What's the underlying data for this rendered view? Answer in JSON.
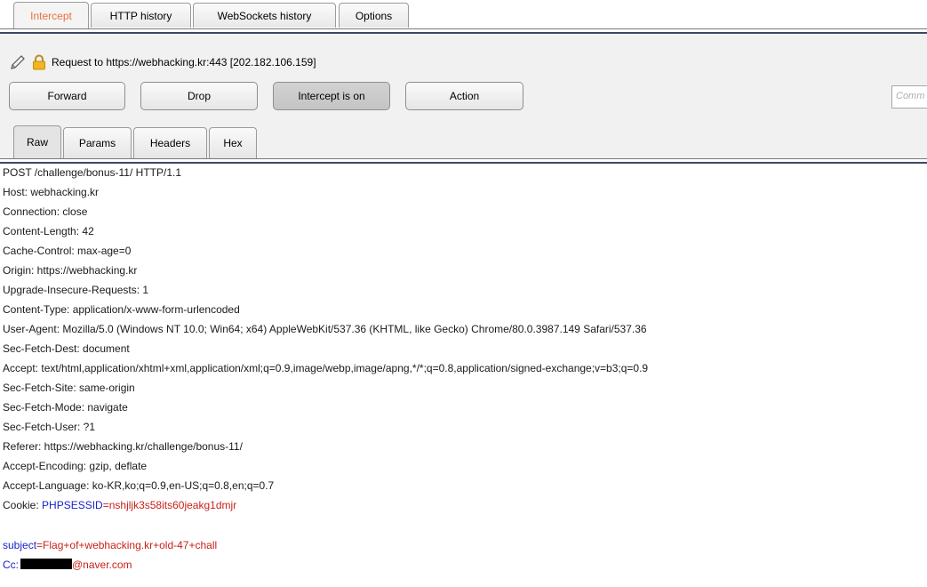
{
  "top_tabs": [
    {
      "label": "Intercept",
      "active": true
    },
    {
      "label": "HTTP history",
      "active": false
    },
    {
      "label": "WebSockets history",
      "active": false
    },
    {
      "label": "Options",
      "active": false
    }
  ],
  "request_line": "Request to https://webhacking.kr:443  [202.182.106.159]",
  "buttons": {
    "forward": "Forward",
    "drop": "Drop",
    "intercept": "Intercept is on",
    "action": "Action"
  },
  "comment_placeholder": "Comm",
  "sub_tabs": [
    {
      "label": "Raw",
      "active": true
    },
    {
      "label": "Params",
      "active": false
    },
    {
      "label": "Headers",
      "active": false
    },
    {
      "label": "Hex",
      "active": false
    }
  ],
  "headers": [
    "POST /challenge/bonus-11/ HTTP/1.1",
    "Host: webhacking.kr",
    "Connection: close",
    "Content-Length: 42",
    "Cache-Control: max-age=0",
    "Origin: https://webhacking.kr",
    "Upgrade-Insecure-Requests: 1",
    "Content-Type: application/x-www-form-urlencoded",
    "User-Agent: Mozilla/5.0 (Windows NT 10.0; Win64; x64) AppleWebKit/537.36 (KHTML, like Gecko) Chrome/80.0.3987.149 Safari/537.36",
    "Sec-Fetch-Dest: document",
    "Accept: text/html,application/xhtml+xml,application/xml;q=0.9,image/webp,image/apng,*/*;q=0.8,application/signed-exchange;v=b3;q=0.9",
    "Sec-Fetch-Site: same-origin",
    "Sec-Fetch-Mode: navigate",
    "Sec-Fetch-User: ?1",
    "Referer: https://webhacking.kr/challenge/bonus-11/",
    "Accept-Encoding: gzip, deflate",
    "Accept-Language: ko-KR,ko;q=0.9,en-US;q=0.8,en;q=0.7"
  ],
  "cookie": {
    "prefix": "Cookie: ",
    "name": "PHPSESSID",
    "value": "=nshjljk3s58its60jeakg1dmjr"
  },
  "body_param": {
    "name": "subject",
    "value": "=Flag+of+webhacking.kr+old-47+chall"
  },
  "cc_line": {
    "name": "Cc:",
    "suffix": "@naver.com"
  },
  "colors": {
    "param_name": "#1a22c8",
    "param_value": "#c8221a",
    "active_tab_text": "#e8713c"
  }
}
